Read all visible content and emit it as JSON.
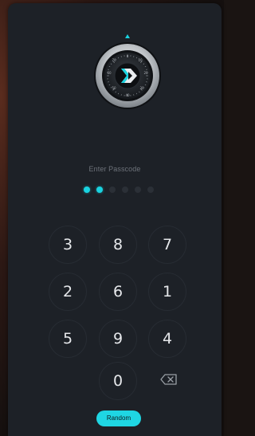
{
  "lock_screen": {
    "prompt": "Enter Passcode",
    "passcode_length": 6,
    "digits_entered": 2,
    "keypad": {
      "rows": [
        [
          "3",
          "8",
          "7"
        ],
        [
          "2",
          "6",
          "1"
        ],
        [
          "5",
          "9",
          "4"
        ]
      ],
      "bottom_key": "0"
    },
    "random_button_label": "Random",
    "colors": {
      "accent": "#1fd6e3",
      "panel": "#1d2127",
      "key_border": "#272c33",
      "label": "#6d727a"
    },
    "icons": {
      "logo": "dial-lock-logo-icon",
      "delete": "backspace-icon"
    }
  }
}
